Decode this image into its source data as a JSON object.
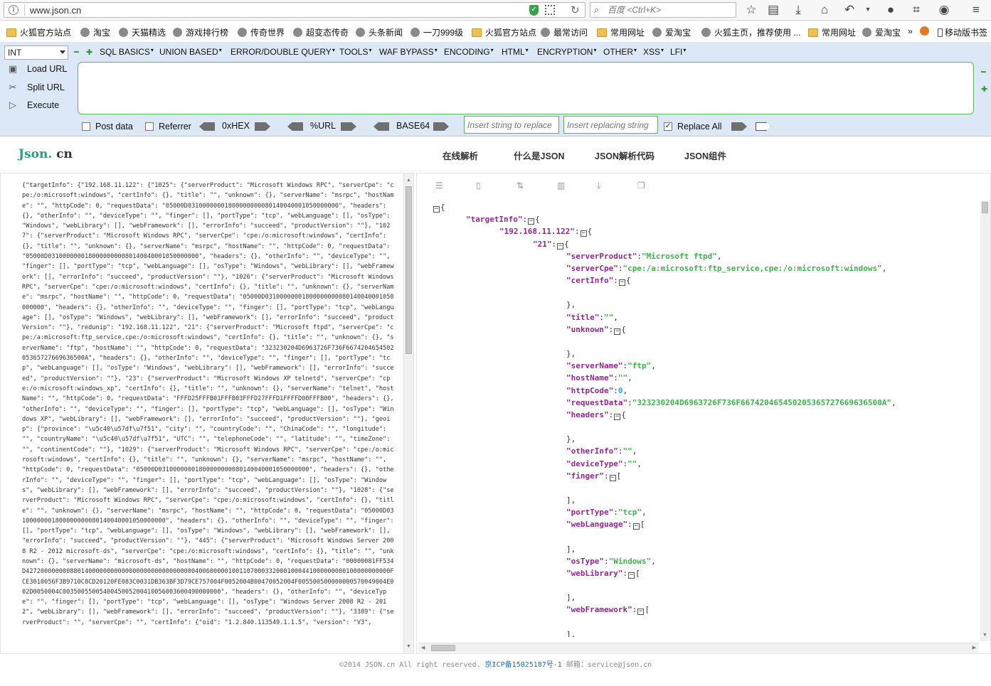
{
  "browser": {
    "url": "www.json.cn",
    "search_placeholder": "百度 <Ctrl+K>"
  },
  "bookmarks": [
    {
      "label": "火狐官方站点",
      "icon": "folder-icon"
    },
    {
      "label": "淘宝",
      "icon": "globe-icon"
    },
    {
      "label": "天猫精选",
      "icon": "globe-icon"
    },
    {
      "label": "游戏排行榜",
      "icon": "globe-icon"
    },
    {
      "label": "传奇世界",
      "icon": "globe-icon"
    },
    {
      "label": "超变态传奇",
      "icon": "globe-icon"
    },
    {
      "label": "头条新闻",
      "icon": "globe-icon"
    },
    {
      "label": "一刀999级",
      "icon": "globe-icon"
    },
    {
      "label": "火狐官方站点",
      "icon": "folder-icon"
    },
    {
      "label": "最常访问",
      "icon": "globe-icon"
    },
    {
      "label": "常用网址",
      "icon": "folder-icon"
    },
    {
      "label": "爱淘宝",
      "icon": "globe-icon"
    },
    {
      "label": "火狐主页，推荐使用 ...",
      "icon": "globe-icon"
    },
    {
      "label": "常用网址",
      "icon": "folder-icon"
    },
    {
      "label": "爱淘宝",
      "icon": "globe-icon"
    }
  ],
  "bookmarks_overflow": "»",
  "mobile_bookmarks": "移动版书签",
  "hackbar": {
    "type_select": "INT",
    "menus": [
      "SQL BASICS",
      "UNION BASED",
      "ERROR/DOUBLE QUERY",
      "TOOLS",
      "WAF BYPASS",
      "ENCODING",
      "HTML",
      "ENCRYPTION",
      "OTHER",
      "XSS",
      "LFI"
    ],
    "load_url": "Load URL",
    "split_url": "Split URL",
    "execute": "Execute",
    "url_value": "",
    "post_data": "Post data",
    "referrer": "Referrer",
    "hex": "0xHEX",
    "url_enc": "%URL",
    "base64": "BASE64",
    "replace_from_placeholder": "Insert string to replace",
    "replace_to_placeholder": "Insert replacing string",
    "replace_all": "Replace All",
    "replace_all_checked": true
  },
  "site": {
    "logo_main": "Json.",
    "logo_suffix": " cn",
    "nav": [
      "在线解析",
      "什么是JSON",
      "JSON解析代码",
      "JSON组件"
    ]
  },
  "raw_json": "{\"targetInfo\": {\"192.168.11.122\": {\"1025\": {\"serverProduct\": \"Microsoft Windows RPC\", \"serverCpe\": \"cpe:/o:microsoft:windows\", \"certInfo\": {}, \"title\": \"\", \"unknown\": {}, \"serverName\": \"msrpc\", \"hostName\": \"\", \"httpCode\": 0, \"requestData\": \"05000D03100000001800000000080140040001050000000\", \"headers\": {}, \"otherInfo\": \"\", \"deviceType\": \"\", \"finger\": [], \"portType\": \"tcp\", \"webLanguage\": [], \"osType\": \"Windows\", \"webLibrary\": [], \"webFramework\": [], \"errorInfo\": \"succeed\", \"productVersion\": \"\"}, \"1027\": {\"serverProduct\": \"Microsoft Windows RPC\", \"serverCpe\": \"cpe:/o:microsoft:windows\", \"certInfo\": {}, \"title\": \"\", \"unknown\": {}, \"serverName\": \"msrpc\", \"hostName\": \"\", \"httpCode\": 0, \"requestData\": \"05000D03100000001800000000080140040001050000000\", \"headers\": {}, \"otherInfo\": \"\", \"deviceType\": \"\", \"finger\": [], \"portType\": \"tcp\", \"webLanguage\": [], \"osType\": \"Windows\", \"webLibrary\": [], \"webFramework\": [], \"errorInfo\": \"succeed\", \"productVersion\": \"\"}, \"1026\": {\"serverProduct\": \"Microsoft Windows RPC\", \"serverCpe\": \"cpe:/o:microsoft:windows\", \"certInfo\": {}, \"title\": \"\", \"unknown\": {}, \"serverName\": \"msrpc\", \"hostName\": \"\", \"httpCode\": 0, \"requestData\": \"05000D03100000001800000000080140040001050000000\", \"headers\": {}, \"otherInfo\": \"\", \"deviceType\": \"\", \"finger\": [], \"portType\": \"tcp\", \"webLanguage\": [], \"osType\": \"Windows\", \"webLibrary\": [], \"webFramework\": [], \"errorInfo\": \"succeed\", \"productVersion\": \"\"}, \"redunip\": \"192.168.11.122\", \"21\": {\"serverProduct\": \"Microsoft ftpd\", \"serverCpe\": \"cpe:/a:microsoft:ftp_service,cpe:/o:microsoft:windows\", \"certInfo\": {}, \"title\": \"\", \"unknown\": {}, \"serverName\": \"ftp\", \"hostName\": \"\", \"httpCode\": 0, \"requestData\": \"323230204D6963726F736F667420465450205365727669636500A\", \"headers\": {}, \"otherInfo\": \"\", \"deviceType\": \"\", \"finger\": [], \"portType\": \"tcp\", \"webLanguage\": [], \"osType\": \"Windows\", \"webLibrary\": [], \"webFramework\": [], \"errorInfo\": \"succeed\", \"productVersion\": \"\"}, \"23\": {\"serverProduct\": \"Microsoft Windows XP telnetd\", \"serverCpe\": \"cpe:/o:microsoft:windows_xp\", \"certInfo\": {}, \"title\": \"\", \"unknown\": {}, \"serverName\": \"telnet\", \"hostName\": \"\", \"httpCode\": 0, \"requestData\": \"FFFD25FFFB01FFFB03FFFD27FFFD1FFFFD00FFFB00\", \"headers\": {}, \"otherInfo\": \"\", \"deviceType\": \"\", \"finger\": [], \"portType\": \"tcp\", \"webLanguage\": [], \"osType\": \"Windows XP\", \"webLibrary\": [], \"webFramework\": [], \"errorInfo\": \"succeed\", \"productVersion\": \"\"}, \"geoip\": {\"province\": \"\\u5c40\\u57df\\u7f51\", \"city\": \"\", \"countryCode\": \"\", \"ChinaCode\": \"\", \"longitude\": \"\", \"countryName\": \"\\u5c40\\u57df\\u7f51\", \"UTC\": \"\", \"telephoneCode\": \"\", \"latitude\": \"\", \"timeZone\": \"\", \"continentCode\": \"\"}, \"1029\": {\"serverProduct\": \"Microsoft Windows RPC\", \"serverCpe\": \"cpe:/o:microsoft:windows\", \"certInfo\": {}, \"title\": \"\", \"unknown\": {}, \"serverName\": \"msrpc\", \"hostName\": \"\", \"httpCode\": 0, \"requestData\": \"05000D03100000001800000000080140040001050000000\", \"headers\": {}, \"otherInfo\": \"\", \"deviceType\": \"\", \"finger\": [], \"portType\": \"tcp\", \"webLanguage\": [], \"osType\": \"Windows\", \"webLibrary\": [], \"webFramework\": [], \"errorInfo\": \"succeed\", \"productVersion\": \"\"}, \"1028\": {\"serverProduct\": \"Microsoft Windows RPC\", \"serverCpe\": \"cpe:/o:microsoft:windows\", \"certInfo\": {}, \"title\": \"\", \"unknown\": {}, \"serverName\": \"msrpc\", \"hostName\": \"\", \"httpCode\": 0, \"requestData\": \"05000D03100000001800000000080140040001050000000\", \"headers\": {}, \"otherInfo\": \"\", \"deviceType\": \"\", \"finger\": [], \"portType\": \"tcp\", \"webLanguage\": [], \"osType\": \"Windows\", \"webLibrary\": [], \"webFramework\": [], \"errorInfo\": \"succeed\", \"productVersion\": \"\"}, \"445\": {\"serverProduct\": \"Microsoft Windows Server 2008 R2 - 2012 microsoft-ds\", \"serverCpe\": \"cpe:/o:microsoft:windows\", \"certInfo\": {}, \"title\": \"\", \"unknown\": {}, \"serverName\": \"microsoft-ds\", \"hostName\": \"\", \"httpCode\": 0, \"requestData\": \"00000081FF534D427200000000880140000000000000000000000000000040060000010011070003320001000441000000000100000000000FCE3010056F3B9710C8CD20120FE083C0031DB363BF3D79CE757004F0052004B00470052004F005500500000000570049004E002D0050004C0035005500540045005200410056003600490000000\", \"headers\": {}, \"otherInfo\": \"\", \"deviceType\": \"\", \"finger\": [], \"portType\": \"tcp\", \"webLanguage\": [], \"osType\": \"Windows Server 2008 R2 - 2012\", \"webLibrary\": [], \"webFramework\": [], \"errorInfo\": \"succeed\", \"productVersion\": \"\"}, \"3389\": {\"serverProduct\": \"\", \"serverCpe\": \"\", \"certInfo\": {\"oid\": \"1.2.840.113549.1.1.5\", \"version\": \"V3\",",
  "tree": [
    {
      "ind": 0,
      "parts": [
        [
          "p",
          "{"
        ]
      ],
      "collapse_before": true
    },
    {
      "ind": 1,
      "parts": [
        [
          "k",
          "\"targetInfo\""
        ],
        [
          "p",
          ":"
        ]
      ],
      "box": true
    },
    {
      "ind": 2,
      "parts": [
        [
          "k",
          "\"192.168.11.122\""
        ],
        [
          "p",
          ":"
        ]
      ],
      "box": true
    },
    {
      "ind": 3,
      "parts": [
        [
          "k",
          "\"21\""
        ],
        [
          "p",
          ":"
        ]
      ],
      "box": true
    },
    {
      "ind": 4,
      "parts": [
        [
          "k",
          "\"serverProduct\""
        ],
        [
          "p",
          ":"
        ],
        [
          "s",
          "\"Microsoft ftpd\""
        ],
        [
          "p",
          ","
        ]
      ]
    },
    {
      "ind": 4,
      "parts": [
        [
          "k",
          "\"serverCpe\""
        ],
        [
          "p",
          ":"
        ],
        [
          "s",
          "\"cpe:/a:microsoft:ftp_service,cpe:/o:microsoft:windows\""
        ],
        [
          "p",
          ","
        ]
      ]
    },
    {
      "ind": 4,
      "parts": [
        [
          "k",
          "\"certInfo\""
        ],
        [
          "p",
          ":"
        ]
      ],
      "box": true
    },
    {
      "ind": 4,
      "parts": [],
      "gap": true
    },
    {
      "ind": 4,
      "parts": [
        [
          "p",
          "},"
        ]
      ]
    },
    {
      "ind": 4,
      "parts": [
        [
          "k",
          "\"title\""
        ],
        [
          "p",
          ":"
        ],
        [
          "s",
          "\"\""
        ],
        [
          "p",
          ","
        ]
      ]
    },
    {
      "ind": 4,
      "parts": [
        [
          "k",
          "\"unknown\""
        ],
        [
          "p",
          ":"
        ]
      ],
      "box": true
    },
    {
      "ind": 4,
      "parts": [],
      "gap": true
    },
    {
      "ind": 4,
      "parts": [
        [
          "p",
          "},"
        ]
      ]
    },
    {
      "ind": 4,
      "parts": [
        [
          "k",
          "\"serverName\""
        ],
        [
          "p",
          ":"
        ],
        [
          "s",
          "\"ftp\""
        ],
        [
          "p",
          ","
        ]
      ]
    },
    {
      "ind": 4,
      "parts": [
        [
          "k",
          "\"hostName\""
        ],
        [
          "p",
          ":"
        ],
        [
          "s",
          "\"\""
        ],
        [
          "p",
          ","
        ]
      ]
    },
    {
      "ind": 4,
      "parts": [
        [
          "k",
          "\"httpCode\""
        ],
        [
          "p",
          ":"
        ],
        [
          "n",
          "0"
        ],
        [
          "p",
          ","
        ]
      ]
    },
    {
      "ind": 4,
      "parts": [
        [
          "k",
          "\"requestData\""
        ],
        [
          "p",
          ":"
        ],
        [
          "s",
          "\"323230204D6963726F736F667420465450205365727669636500A\""
        ],
        [
          "p",
          ","
        ]
      ]
    },
    {
      "ind": 4,
      "parts": [
        [
          "k",
          "\"headers\""
        ],
        [
          "p",
          ":"
        ]
      ],
      "box": true
    },
    {
      "ind": 4,
      "parts": [],
      "gap": true
    },
    {
      "ind": 4,
      "parts": [
        [
          "p",
          "},"
        ]
      ]
    },
    {
      "ind": 4,
      "parts": [
        [
          "k",
          "\"otherInfo\""
        ],
        [
          "p",
          ":"
        ],
        [
          "s",
          "\"\""
        ],
        [
          "p",
          ","
        ]
      ]
    },
    {
      "ind": 4,
      "parts": [
        [
          "k",
          "\"deviceType\""
        ],
        [
          "p",
          ":"
        ],
        [
          "s",
          "\"\""
        ],
        [
          "p",
          ","
        ]
      ]
    },
    {
      "ind": 4,
      "parts": [
        [
          "k",
          "\"finger\""
        ],
        [
          "p",
          ":"
        ]
      ],
      "box": true,
      "bracket": "["
    },
    {
      "ind": 4,
      "parts": [],
      "gap": true
    },
    {
      "ind": 4,
      "parts": [
        [
          "p",
          "],"
        ]
      ]
    },
    {
      "ind": 4,
      "parts": [
        [
          "k",
          "\"portType\""
        ],
        [
          "p",
          ":"
        ],
        [
          "s",
          "\"tcp\""
        ],
        [
          "p",
          ","
        ]
      ]
    },
    {
      "ind": 4,
      "parts": [
        [
          "k",
          "\"webLanguage\""
        ],
        [
          "p",
          ":"
        ]
      ],
      "box": true,
      "bracket": "["
    },
    {
      "ind": 4,
      "parts": [],
      "gap": true
    },
    {
      "ind": 4,
      "parts": [
        [
          "p",
          "],"
        ]
      ]
    },
    {
      "ind": 4,
      "parts": [
        [
          "k",
          "\"osType\""
        ],
        [
          "p",
          ":"
        ],
        [
          "s",
          "\"Windows\""
        ],
        [
          "p",
          ","
        ]
      ]
    },
    {
      "ind": 4,
      "parts": [
        [
          "k",
          "\"webLibrary\""
        ],
        [
          "p",
          ":"
        ]
      ],
      "box": true,
      "bracket": "["
    },
    {
      "ind": 4,
      "parts": [],
      "gap": true
    },
    {
      "ind": 4,
      "parts": [
        [
          "p",
          "],"
        ]
      ]
    },
    {
      "ind": 4,
      "parts": [
        [
          "k",
          "\"webFramework\""
        ],
        [
          "p",
          ":"
        ]
      ],
      "box": true,
      "bracket": "["
    },
    {
      "ind": 4,
      "parts": [],
      "gap": true
    },
    {
      "ind": 4,
      "parts": [
        [
          "p",
          "],"
        ]
      ]
    }
  ],
  "footer": {
    "copy": "©2014 JSON.cn All right reserved. ",
    "icp": "京ICP备15025187号-1",
    "mail": " 邮箱：service@json.cn"
  }
}
